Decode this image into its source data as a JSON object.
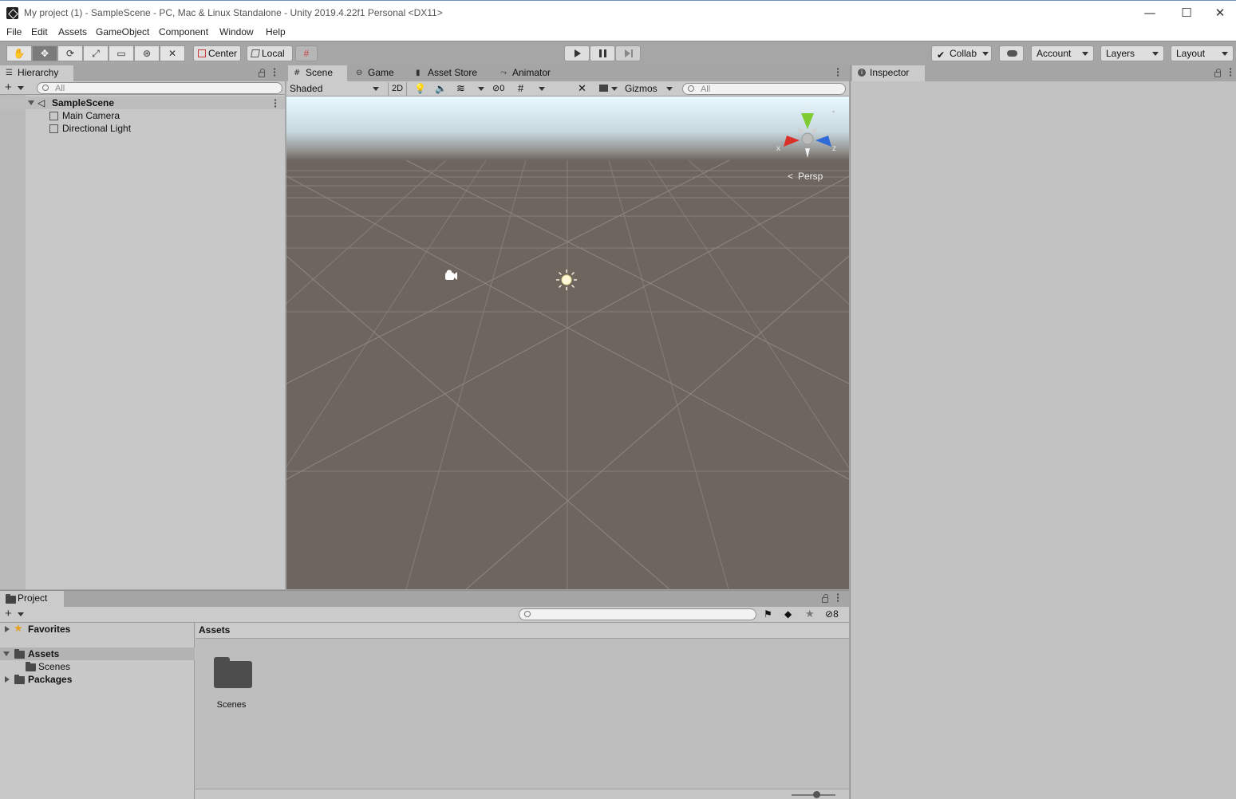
{
  "window": {
    "title": "My project (1) - SampleScene - PC, Mac & Linux Standalone - Unity 2019.4.22f1 Personal <DX11>",
    "minimize_glyph": "—",
    "maximize_glyph": "☐",
    "close_glyph": "✕"
  },
  "menu": [
    "File",
    "Edit",
    "Assets",
    "GameObject",
    "Component",
    "Window",
    "Help"
  ],
  "toolbar": {
    "tools": [
      "hand-tool",
      "move-tool",
      "rotate-tool",
      "scale-tool",
      "rect-tool",
      "transform-tool",
      "custom-tool"
    ],
    "active_tool": "move-tool",
    "pivot_label": "Center",
    "space_label": "Local",
    "collab_label": "Collab",
    "account_label": "Account",
    "layers_label": "Layers",
    "layout_label": "Layout"
  },
  "hierarchy": {
    "tab_label": "Hierarchy",
    "search_placeholder": "All",
    "scene_name": "SampleScene",
    "items": [
      "Main Camera",
      "Directional Light"
    ]
  },
  "scene": {
    "tabs": [
      "Scene",
      "Game",
      "Asset Store",
      "Animator"
    ],
    "active_tab": "Scene",
    "shading_mode": "Shaded",
    "mode_2d_label": "2D",
    "hidden_count": "0",
    "gizmos_label": "Gizmos",
    "search_placeholder": "All",
    "projection_label": "Persp",
    "axis_labels": {
      "y": "y",
      "x": "x",
      "z": "z"
    }
  },
  "inspector": {
    "tab_label": "Inspector"
  },
  "project": {
    "tab_label": "Project",
    "hidden_count": "8",
    "tree": {
      "favorites": "Favorites",
      "assets": "Assets",
      "scenes": "Scenes",
      "packages": "Packages"
    },
    "breadcrumb": "Assets",
    "grid_items": [
      "Scenes"
    ]
  },
  "colors": {
    "panel_bg": "#c2c2c2",
    "toolbar_bg": "#a6a6a6",
    "sky_top": "#e8f8ff",
    "ground": "#6e655f",
    "axis_x": "#d9302a",
    "axis_y": "#7fcc32",
    "axis_z": "#2f6ad8",
    "star": "#e6a020"
  }
}
